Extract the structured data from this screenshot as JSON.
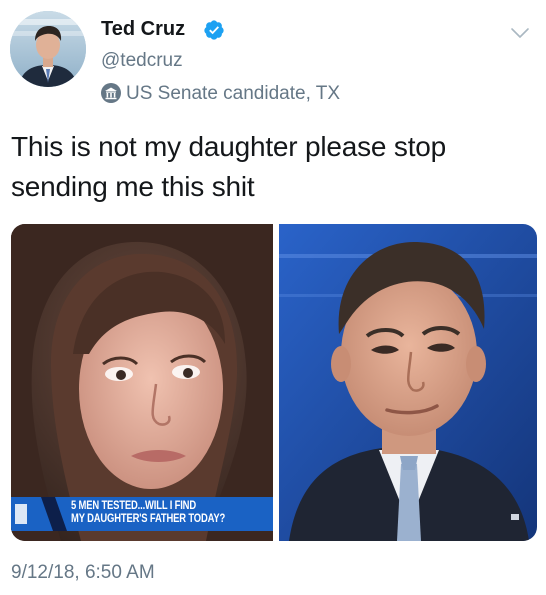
{
  "author": {
    "display_name": "Ted Cruz",
    "handle": "@tedcruz",
    "verified": true,
    "label": "US Senate candidate, TX",
    "avatar_icon": "profile-photo"
  },
  "tweet": {
    "text_line_1": "This is not my daughter please stop",
    "text_line_2": "sending me this shit",
    "timestamp": "9/12/18, 6:50 AM"
  },
  "media": {
    "left_photo": {
      "chyron_line_1": "5 MEN TESTED...WILL I FIND",
      "chyron_line_2": "MY DAUGHTER'S FATHER TODAY?"
    },
    "right_photo": {}
  },
  "icons": {
    "verified": "verified-badge-icon",
    "menu": "chevron-down-icon",
    "label": "government-building-icon"
  },
  "colors": {
    "text_primary": "#14171a",
    "text_secondary": "#657786",
    "verified_blue": "#1da1f2",
    "chyron_blue": "#1a62c4",
    "studio_blue": "#1d4fa8"
  }
}
